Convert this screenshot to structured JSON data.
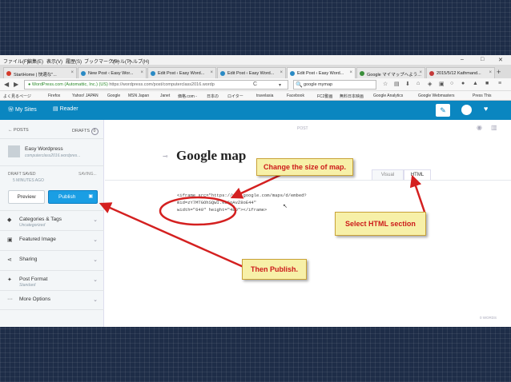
{
  "menu": {
    "items": [
      "ファイル(F)",
      "編集(E)",
      "表示(V)",
      "履歴(S)",
      "ブックマーク(B)",
      "ツール(T)",
      "ヘルプ(H)"
    ]
  },
  "window": {
    "minimize": "–",
    "maximize": "□",
    "close": "✕"
  },
  "tabs": [
    {
      "label": "StartHome | 快適な\"..."
    },
    {
      "label": "New Post ‹ Easy Wor..."
    },
    {
      "label": "Edit Post ‹ Easy Word..."
    },
    {
      "label": "Edit Post ‹ Easy Word..."
    },
    {
      "label": "Edit Post ‹ Easy Word..."
    },
    {
      "label": "Google マイマップへよう..."
    },
    {
      "label": "2015/5/12 Kathmand..."
    }
  ],
  "nav": {
    "back": "◀",
    "forward": "▶",
    "url_site": "WordPress.com (Automattic, Inc.) (US)",
    "url_path": "https://wordpress.com/post/computerclass2016.wordp",
    "reload": "C",
    "dropdown": "▾",
    "search_value": "google mymap",
    "search_icon": "🔍"
  },
  "bookmarks": [
    "よく見るページ",
    "Firefox",
    "Yahoo! JAPAN",
    "Google",
    "MSN Japan",
    "Janet",
    "価格.com -",
    "日本の",
    "ロイター",
    "travelasia",
    "Facebook",
    "FC2動画",
    "無料日本映画",
    "Google Analytics",
    "Google Webmasters",
    "Press This"
  ],
  "wp": {
    "my_sites": "My Sites",
    "reader": "Reader"
  },
  "sidebar": {
    "posts": "POSTS",
    "drafts": "DRAFTS",
    "drafts_count": "0",
    "site_name": "Easy Wordpress",
    "site_url": "computerclass2016.wordpres...",
    "draft_saved": "DRAFT SAVED",
    "saving": "SAVING...",
    "time_ago": "5 MINUTES AGO",
    "preview": "Preview",
    "publish": "Publish",
    "items": [
      {
        "label": "Categories & Tags",
        "sub": "Uncategorized"
      },
      {
        "label": "Featured Image",
        "sub": ""
      },
      {
        "label": "Sharing",
        "sub": ""
      },
      {
        "label": "Post Format",
        "sub": "Standard"
      },
      {
        "label": "More Options",
        "sub": ""
      }
    ]
  },
  "editor": {
    "post_label": "POST",
    "title": "Google map",
    "tab_visual": "Visual",
    "tab_html": "HTML",
    "code_line1": "<iframe src=\"https://www.google.com/maps/d/embed?mid=zY7MTGOhSQWI.k85oAvZ8oE44\"",
    "code_line2": "width=\"640\" height=\"480\"></iframe>",
    "word_count": "0 WORDS"
  },
  "callouts": {
    "size": "Change the size of map.",
    "html": "Select HTML section",
    "publish": "Then Publish."
  },
  "colors": {
    "wp_blue": "#0a86c0",
    "publish_blue": "#1a9ee4",
    "annotation_red": "#d42020",
    "callout_bg": "#f7f0a8"
  }
}
